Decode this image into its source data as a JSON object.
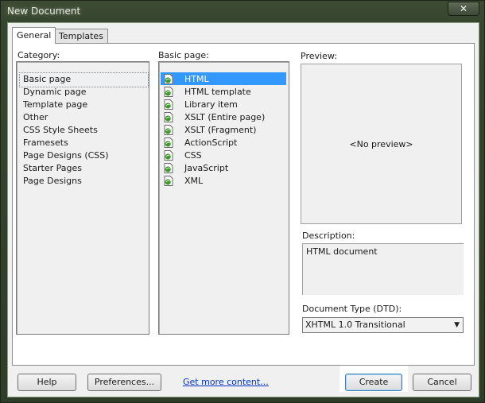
{
  "window": {
    "title": "New Document",
    "close_glyph": "✕"
  },
  "tabs": [
    {
      "label": "General"
    },
    {
      "label": "Templates"
    }
  ],
  "category": {
    "label": "Category:",
    "items": [
      "Basic page",
      "Dynamic page",
      "Template page",
      "Other",
      "CSS Style Sheets",
      "Framesets",
      "Page Designs (CSS)",
      "Starter Pages",
      "Page Designs"
    ],
    "selected": "Basic page"
  },
  "basic_page": {
    "label": "Basic page:",
    "items": [
      "HTML",
      "HTML template",
      "Library item",
      "XSLT (Entire page)",
      "XSLT (Fragment)",
      "ActionScript",
      "CSS",
      "JavaScript",
      "XML"
    ],
    "selected": "HTML",
    "icon": "document-icon"
  },
  "preview": {
    "label": "Preview:",
    "text": "<No preview>"
  },
  "description": {
    "label": "Description:",
    "text": "HTML document"
  },
  "doctype": {
    "label": "Document Type (DTD):",
    "value": "XHTML 1.0 Transitional"
  },
  "buttons": {
    "help": "Help",
    "preferences": "Preferences...",
    "create": "Create",
    "cancel": "Cancel"
  },
  "link": {
    "get_more": "Get more content..."
  },
  "colors": {
    "selection": "#3399ff",
    "link": "#0033cc",
    "chrome": "#36462e"
  }
}
